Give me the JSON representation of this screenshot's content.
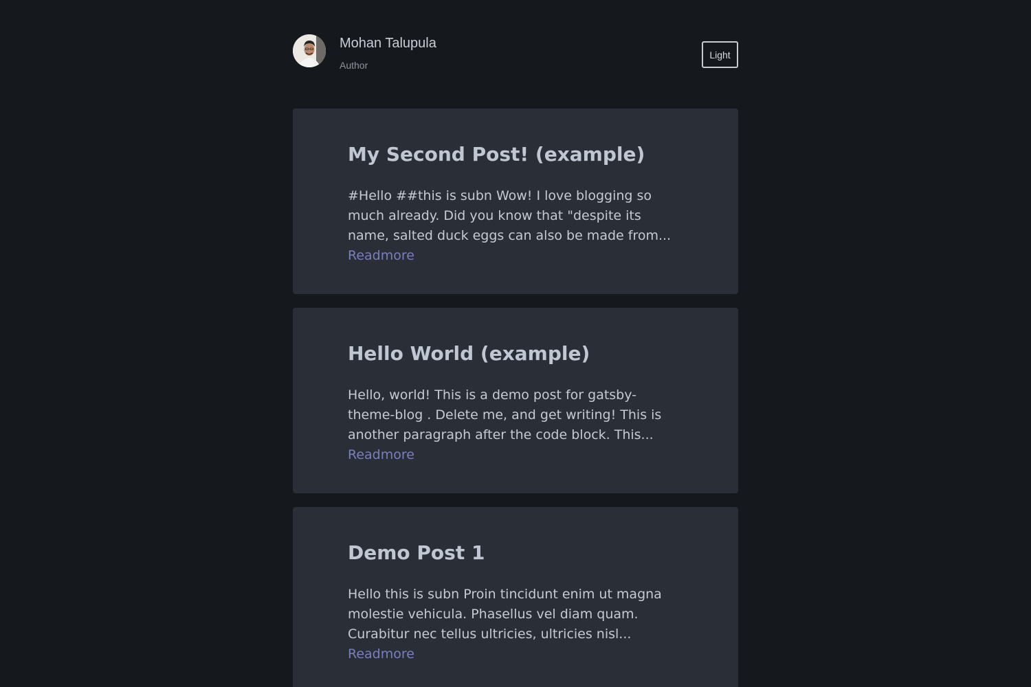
{
  "header": {
    "author_name": "Mohan Talupula",
    "author_role": "Author",
    "theme_toggle_label": "Light"
  },
  "posts": [
    {
      "title": "My Second Post! (example)",
      "excerpt": "#Hello ##this is subn Wow! I love blogging so much already. Did you know that \"despite its name, salted duck eggs can also be made from...",
      "readmore": "Readmore"
    },
    {
      "title": "Hello World (example)",
      "excerpt": "Hello, world! This is a demo post for gatsby-theme-blog . Delete me, and get writing! This is another paragraph after the code block. This...",
      "readmore": "Readmore"
    },
    {
      "title": "Demo Post 1",
      "excerpt": "Hello this is subn Proin tincidunt enim ut magna molestie vehicula. Phasellus vel diam quam. Curabitur nec tellus ultricies, ultricies nisl...",
      "readmore": "Readmore"
    }
  ],
  "colors": {
    "background": "#15191d",
    "card": "#2a2e36",
    "title": "#c0c6d2",
    "text": "#c6cad2",
    "link": "#7b7fbf"
  }
}
